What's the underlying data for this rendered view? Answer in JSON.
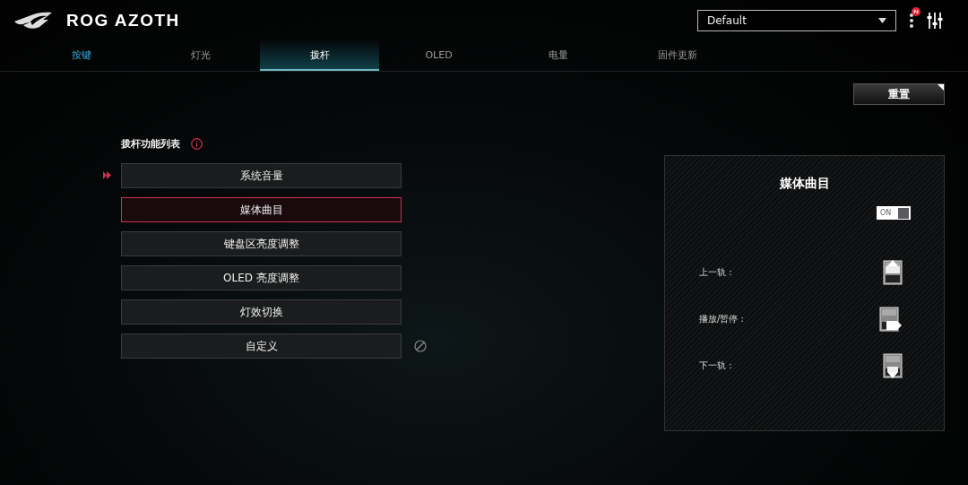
{
  "app": {
    "title": "ROG AZOTH"
  },
  "profile": {
    "value": "Default"
  },
  "tabs": [
    {
      "label": "按键",
      "selected": false,
      "hovered": true
    },
    {
      "label": "灯光",
      "selected": false,
      "hovered": false
    },
    {
      "label": "拨杆",
      "selected": true,
      "hovered": false
    },
    {
      "label": "OLED",
      "selected": false,
      "hovered": false
    },
    {
      "label": "电量",
      "selected": false,
      "hovered": false
    },
    {
      "label": "固件更新",
      "selected": false,
      "hovered": false
    }
  ],
  "reset_button": "重置",
  "function_list": {
    "title": "拨杆功能列表",
    "items": [
      {
        "label": "系统音量",
        "selected": false,
        "current": true,
        "clearable": false
      },
      {
        "label": "媒体曲目",
        "selected": true,
        "current": false,
        "clearable": false
      },
      {
        "label": "键盘区亮度调整",
        "selected": false,
        "current": false,
        "clearable": false
      },
      {
        "label": "OLED 亮度调整",
        "selected": false,
        "current": false,
        "clearable": false
      },
      {
        "label": "灯效切换",
        "selected": false,
        "current": false,
        "clearable": false
      },
      {
        "label": "自定义",
        "selected": false,
        "current": false,
        "clearable": true
      }
    ]
  },
  "detail": {
    "title": "媒体曲目",
    "toggle": {
      "label": "ON",
      "on": true
    },
    "actions": [
      {
        "label": "上一轨 :",
        "kind": "up"
      },
      {
        "label": "播放/暂停 :",
        "kind": "press"
      },
      {
        "label": "下一轨 :",
        "kind": "down"
      }
    ]
  }
}
